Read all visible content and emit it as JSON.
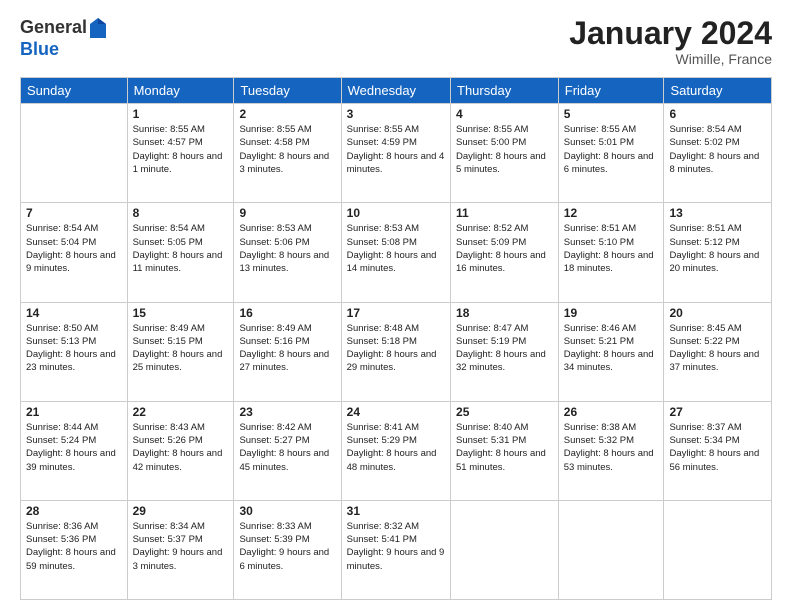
{
  "logo": {
    "general": "General",
    "blue": "Blue"
  },
  "title": "January 2024",
  "location": "Wimille, France",
  "days_of_week": [
    "Sunday",
    "Monday",
    "Tuesday",
    "Wednesday",
    "Thursday",
    "Friday",
    "Saturday"
  ],
  "weeks": [
    [
      {
        "day": "",
        "sunrise": "",
        "sunset": "",
        "daylight": ""
      },
      {
        "day": "1",
        "sunrise": "8:55 AM",
        "sunset": "4:57 PM",
        "daylight": "8 hours and 1 minute."
      },
      {
        "day": "2",
        "sunrise": "8:55 AM",
        "sunset": "4:58 PM",
        "daylight": "8 hours and 3 minutes."
      },
      {
        "day": "3",
        "sunrise": "8:55 AM",
        "sunset": "4:59 PM",
        "daylight": "8 hours and 4 minutes."
      },
      {
        "day": "4",
        "sunrise": "8:55 AM",
        "sunset": "5:00 PM",
        "daylight": "8 hours and 5 minutes."
      },
      {
        "day": "5",
        "sunrise": "8:55 AM",
        "sunset": "5:01 PM",
        "daylight": "8 hours and 6 minutes."
      },
      {
        "day": "6",
        "sunrise": "8:54 AM",
        "sunset": "5:02 PM",
        "daylight": "8 hours and 8 minutes."
      }
    ],
    [
      {
        "day": "7",
        "sunrise": "8:54 AM",
        "sunset": "5:04 PM",
        "daylight": "8 hours and 9 minutes."
      },
      {
        "day": "8",
        "sunrise": "8:54 AM",
        "sunset": "5:05 PM",
        "daylight": "8 hours and 11 minutes."
      },
      {
        "day": "9",
        "sunrise": "8:53 AM",
        "sunset": "5:06 PM",
        "daylight": "8 hours and 13 minutes."
      },
      {
        "day": "10",
        "sunrise": "8:53 AM",
        "sunset": "5:08 PM",
        "daylight": "8 hours and 14 minutes."
      },
      {
        "day": "11",
        "sunrise": "8:52 AM",
        "sunset": "5:09 PM",
        "daylight": "8 hours and 16 minutes."
      },
      {
        "day": "12",
        "sunrise": "8:51 AM",
        "sunset": "5:10 PM",
        "daylight": "8 hours and 18 minutes."
      },
      {
        "day": "13",
        "sunrise": "8:51 AM",
        "sunset": "5:12 PM",
        "daylight": "8 hours and 20 minutes."
      }
    ],
    [
      {
        "day": "14",
        "sunrise": "8:50 AM",
        "sunset": "5:13 PM",
        "daylight": "8 hours and 23 minutes."
      },
      {
        "day": "15",
        "sunrise": "8:49 AM",
        "sunset": "5:15 PM",
        "daylight": "8 hours and 25 minutes."
      },
      {
        "day": "16",
        "sunrise": "8:49 AM",
        "sunset": "5:16 PM",
        "daylight": "8 hours and 27 minutes."
      },
      {
        "day": "17",
        "sunrise": "8:48 AM",
        "sunset": "5:18 PM",
        "daylight": "8 hours and 29 minutes."
      },
      {
        "day": "18",
        "sunrise": "8:47 AM",
        "sunset": "5:19 PM",
        "daylight": "8 hours and 32 minutes."
      },
      {
        "day": "19",
        "sunrise": "8:46 AM",
        "sunset": "5:21 PM",
        "daylight": "8 hours and 34 minutes."
      },
      {
        "day": "20",
        "sunrise": "8:45 AM",
        "sunset": "5:22 PM",
        "daylight": "8 hours and 37 minutes."
      }
    ],
    [
      {
        "day": "21",
        "sunrise": "8:44 AM",
        "sunset": "5:24 PM",
        "daylight": "8 hours and 39 minutes."
      },
      {
        "day": "22",
        "sunrise": "8:43 AM",
        "sunset": "5:26 PM",
        "daylight": "8 hours and 42 minutes."
      },
      {
        "day": "23",
        "sunrise": "8:42 AM",
        "sunset": "5:27 PM",
        "daylight": "8 hours and 45 minutes."
      },
      {
        "day": "24",
        "sunrise": "8:41 AM",
        "sunset": "5:29 PM",
        "daylight": "8 hours and 48 minutes."
      },
      {
        "day": "25",
        "sunrise": "8:40 AM",
        "sunset": "5:31 PM",
        "daylight": "8 hours and 51 minutes."
      },
      {
        "day": "26",
        "sunrise": "8:38 AM",
        "sunset": "5:32 PM",
        "daylight": "8 hours and 53 minutes."
      },
      {
        "day": "27",
        "sunrise": "8:37 AM",
        "sunset": "5:34 PM",
        "daylight": "8 hours and 56 minutes."
      }
    ],
    [
      {
        "day": "28",
        "sunrise": "8:36 AM",
        "sunset": "5:36 PM",
        "daylight": "8 hours and 59 minutes."
      },
      {
        "day": "29",
        "sunrise": "8:34 AM",
        "sunset": "5:37 PM",
        "daylight": "9 hours and 3 minutes."
      },
      {
        "day": "30",
        "sunrise": "8:33 AM",
        "sunset": "5:39 PM",
        "daylight": "9 hours and 6 minutes."
      },
      {
        "day": "31",
        "sunrise": "8:32 AM",
        "sunset": "5:41 PM",
        "daylight": "9 hours and 9 minutes."
      },
      {
        "day": "",
        "sunrise": "",
        "sunset": "",
        "daylight": ""
      },
      {
        "day": "",
        "sunrise": "",
        "sunset": "",
        "daylight": ""
      },
      {
        "day": "",
        "sunrise": "",
        "sunset": "",
        "daylight": ""
      }
    ]
  ]
}
